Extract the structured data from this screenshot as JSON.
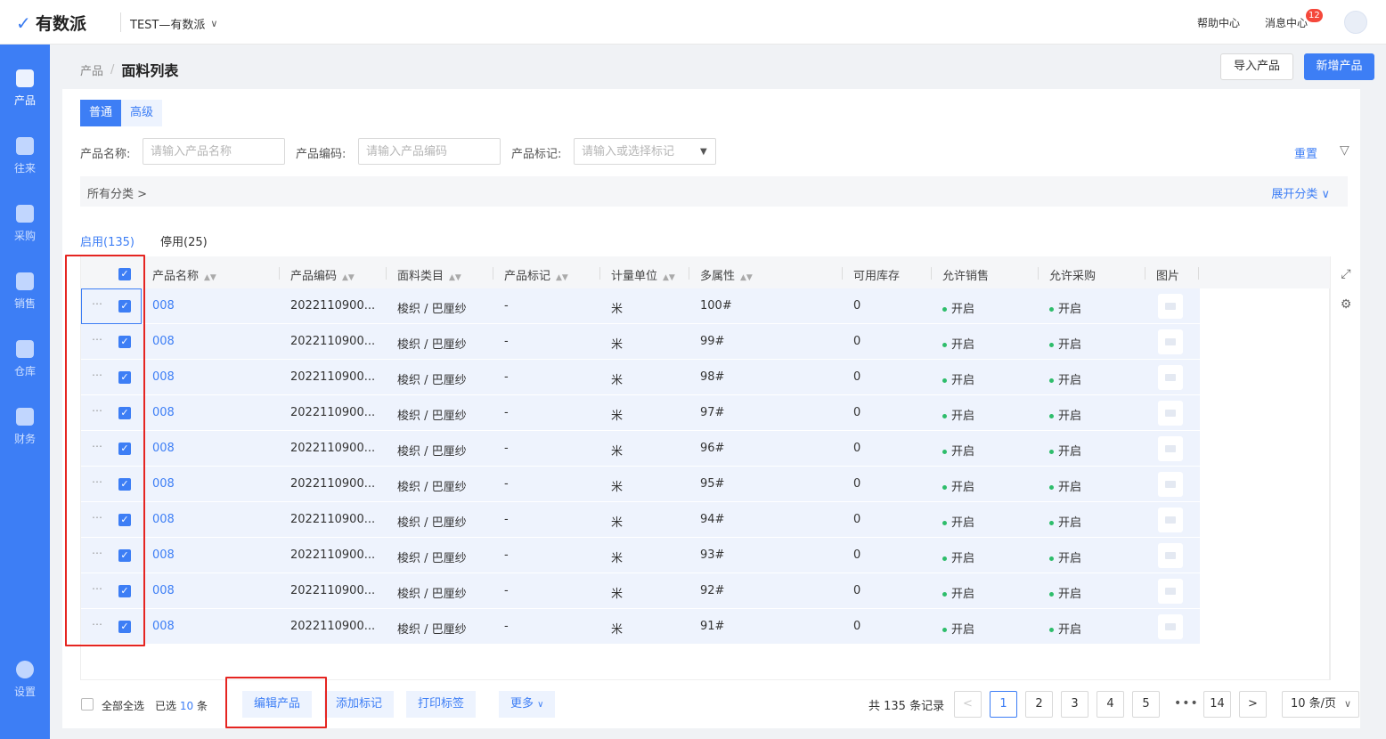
{
  "header": {
    "logo_text": "有数派",
    "org_name": "TEST—有数派",
    "help": "帮助中心",
    "messages": "消息中心",
    "message_count": "12"
  },
  "sidebar": {
    "items": [
      {
        "label": "产品",
        "icon": "box-icon",
        "active": true
      },
      {
        "label": "往来",
        "icon": "contact-icon"
      },
      {
        "label": "采购",
        "icon": "cart-icon"
      },
      {
        "label": "销售",
        "icon": "clipboard-icon"
      },
      {
        "label": "仓库",
        "icon": "warehouse-icon"
      },
      {
        "label": "财务",
        "icon": "yen-icon"
      },
      {
        "label": "设置",
        "icon": "gear-icon"
      }
    ]
  },
  "breadcrumb": {
    "parent": "产品",
    "separator": "/",
    "current": "面料列表"
  },
  "actions": {
    "import": "导入产品",
    "add": "新增产品"
  },
  "mode_tabs": {
    "normal": "普通",
    "advanced": "高级"
  },
  "filters": {
    "name_label": "产品名称:",
    "name_placeholder": "请输入产品名称",
    "code_label": "产品编码:",
    "code_placeholder": "请输入产品编码",
    "tag_label": "产品标记:",
    "tag_placeholder": "请输入或选择标记",
    "reset": "重置"
  },
  "category": {
    "path": "所有分类 >",
    "expand": "展开分类"
  },
  "status_tabs": {
    "enabled": "启用(135)",
    "disabled": "停用(25)"
  },
  "table": {
    "columns": [
      "产品名称",
      "产品编码",
      "面料类目",
      "产品标记",
      "计量单位",
      "多属性",
      "可用库存",
      "允许销售",
      "允许采购",
      "图片"
    ],
    "rows": [
      {
        "name": "008",
        "code": "2022110900...",
        "category": "梭织 / 巴厘纱",
        "tag": "-",
        "unit": "米",
        "attr": "100#",
        "stock": "0",
        "sale": "开启",
        "purchase": "开启"
      },
      {
        "name": "008",
        "code": "2022110900...",
        "category": "梭织 / 巴厘纱",
        "tag": "-",
        "unit": "米",
        "attr": "99#",
        "stock": "0",
        "sale": "开启",
        "purchase": "开启"
      },
      {
        "name": "008",
        "code": "2022110900...",
        "category": "梭织 / 巴厘纱",
        "tag": "-",
        "unit": "米",
        "attr": "98#",
        "stock": "0",
        "sale": "开启",
        "purchase": "开启"
      },
      {
        "name": "008",
        "code": "2022110900...",
        "category": "梭织 / 巴厘纱",
        "tag": "-",
        "unit": "米",
        "attr": "97#",
        "stock": "0",
        "sale": "开启",
        "purchase": "开启"
      },
      {
        "name": "008",
        "code": "2022110900...",
        "category": "梭织 / 巴厘纱",
        "tag": "-",
        "unit": "米",
        "attr": "96#",
        "stock": "0",
        "sale": "开启",
        "purchase": "开启"
      },
      {
        "name": "008",
        "code": "2022110900...",
        "category": "梭织 / 巴厘纱",
        "tag": "-",
        "unit": "米",
        "attr": "95#",
        "stock": "0",
        "sale": "开启",
        "purchase": "开启"
      },
      {
        "name": "008",
        "code": "2022110900...",
        "category": "梭织 / 巴厘纱",
        "tag": "-",
        "unit": "米",
        "attr": "94#",
        "stock": "0",
        "sale": "开启",
        "purchase": "开启"
      },
      {
        "name": "008",
        "code": "2022110900...",
        "category": "梭织 / 巴厘纱",
        "tag": "-",
        "unit": "米",
        "attr": "93#",
        "stock": "0",
        "sale": "开启",
        "purchase": "开启"
      },
      {
        "name": "008",
        "code": "2022110900...",
        "category": "梭织 / 巴厘纱",
        "tag": "-",
        "unit": "米",
        "attr": "92#",
        "stock": "0",
        "sale": "开启",
        "purchase": "开启"
      },
      {
        "name": "008",
        "code": "2022110900...",
        "category": "梭织 / 巴厘纱",
        "tag": "-",
        "unit": "米",
        "attr": "91#",
        "stock": "0",
        "sale": "开启",
        "purchase": "开启"
      }
    ]
  },
  "footer": {
    "select_all": "全部全选",
    "selected_prefix": "已选",
    "selected_count": "10",
    "selected_suffix": "条",
    "edit": "编辑产品",
    "add_tag": "添加标记",
    "print": "打印标签",
    "more": "更多",
    "total": "共 135 条记录",
    "pages": [
      "1",
      "2",
      "3",
      "4",
      "5",
      "14"
    ],
    "current_page": "1",
    "page_size": "10 条/页"
  },
  "colors": {
    "primary": "#3d7ef5",
    "status_on": "#2ebd6b",
    "highlight": "#e52521"
  }
}
